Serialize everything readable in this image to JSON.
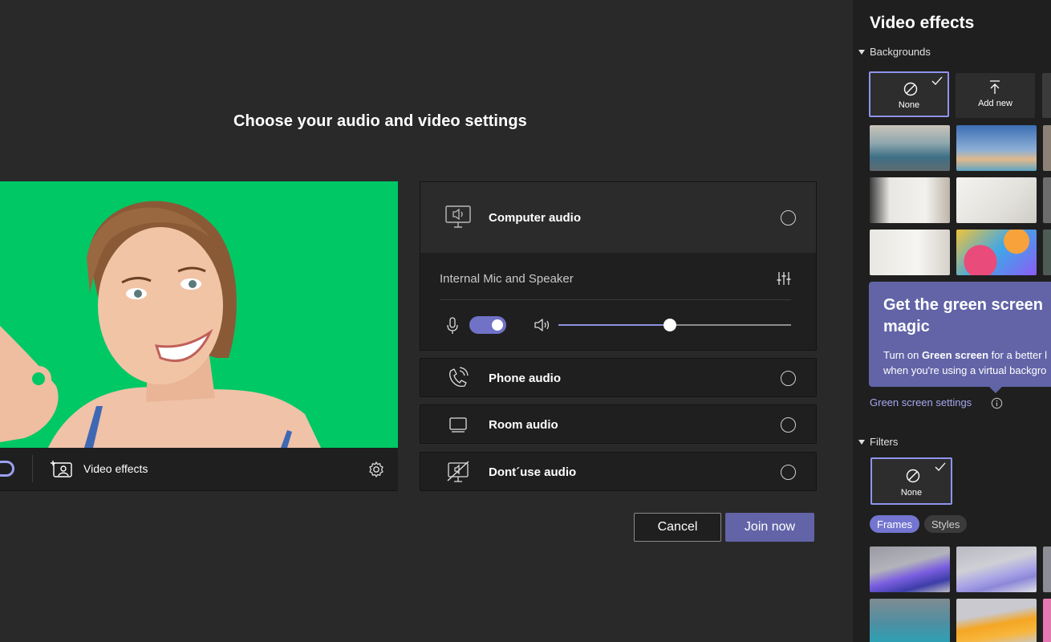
{
  "heading": "Choose your audio and video settings",
  "preview": {
    "video_effects_label": "Video effects"
  },
  "audio": {
    "computer_audio": "Computer audio",
    "device": "Internal Mic and Speaker",
    "mic_on": true,
    "volume": 0.48,
    "phone_audio": "Phone audio",
    "room_audio": "Room audio",
    "dont_use_audio": "Dont´use audio"
  },
  "buttons": {
    "cancel": "Cancel",
    "join": "Join now"
  },
  "side": {
    "title": "Video effects",
    "backgrounds_label": "Backgrounds",
    "none_label": "None",
    "add_new_label": "Add new",
    "callout_title": "Get the green screen magic",
    "callout_line1_pre": "Turn on ",
    "callout_line1_bold": "Green screen",
    "callout_line1_post": " for a better l",
    "callout_line2": "when you're using a virtual backgro",
    "green_screen_link": "Green screen settings",
    "filters_label": "Filters",
    "filter_none_label": "None",
    "tab_frames": "Frames",
    "tab_styles": "Styles"
  },
  "colors": {
    "accent": "#6264a7",
    "green_screen": "#00c865",
    "panel_bg": "#1f1f1f",
    "page_bg": "#292929"
  }
}
